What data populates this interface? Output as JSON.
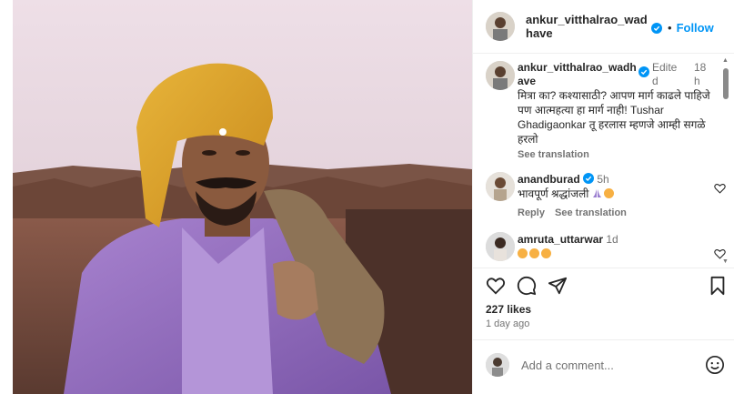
{
  "post": {
    "author": "ankur_vitthalrao_wadhave",
    "follow_label": "Follow",
    "dot": "•",
    "likes": "227 likes",
    "time_ago": "1 day ago",
    "add_comment_placeholder": "Add a comment..."
  },
  "comments": [
    {
      "user": "ankur_vitthalrao_wadhave",
      "edited": "Edited",
      "time": "18h",
      "text": "मित्रा का? कश्यासाठी? आपण मार्ग काढले पाहिजे पण आत्महत्या हा मार्ग नाही! Tushar Ghadigaonkar तू हरलास म्हणजे आम्ही सगळे हरलो",
      "see_translation": "See translation"
    },
    {
      "user": "anandburad",
      "time": "5h",
      "text": "भावपूर्ण श्रद्धांजली",
      "reply": "Reply",
      "see_translation": "See translation"
    },
    {
      "user": "amruta_uttarwar",
      "time": "1d",
      "text": ""
    }
  ],
  "icons": {
    "like": "heart-icon",
    "comment": "comment-icon",
    "share": "send-icon",
    "save": "bookmark-icon",
    "emoji": "smiley-icon",
    "verified": "verified-badge-icon"
  },
  "colors": {
    "accent": "#0095f6",
    "verified": "#0095f6",
    "text": "#262626",
    "muted": "#737373"
  }
}
